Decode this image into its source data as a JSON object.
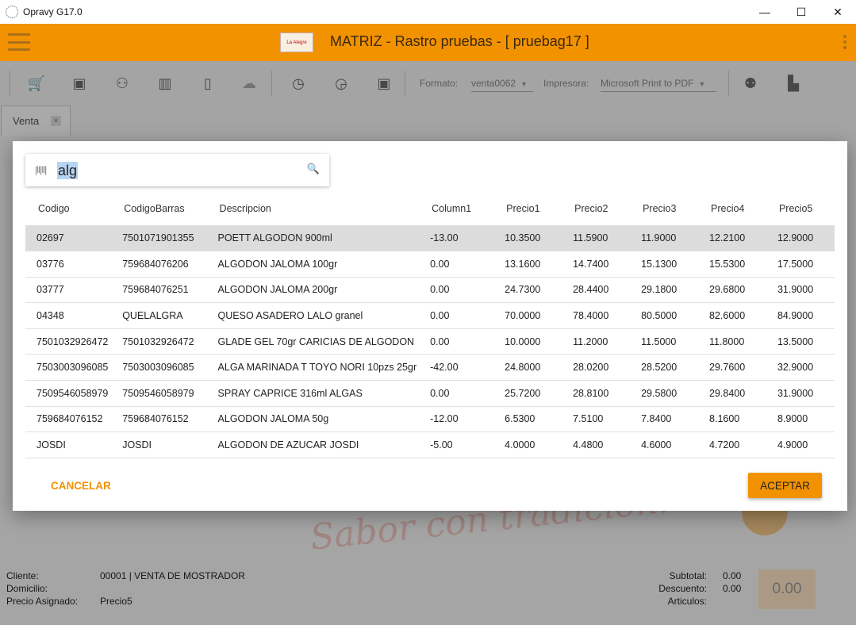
{
  "window": {
    "title": "Opravy G17.0",
    "minimize": "—",
    "maximize": "☐",
    "close": "✕"
  },
  "appbar": {
    "title": "MATRIZ - Rastro pruebas - [ pruebag17 ]",
    "logo_text": "La Alegre"
  },
  "toolbar": {
    "formato_label": "Formato:",
    "formato_value": "venta0062",
    "impresora_label": "Impresora:",
    "impresora_value": "Microsoft Print to PDF"
  },
  "tab": {
    "label": "Venta",
    "close": "✕"
  },
  "watermark": "Sabor con tradición!!",
  "footer": {
    "cliente_label": "Cliente:",
    "cliente_value": "00001 | VENTA DE MOSTRADOR",
    "domicilio_label": "Domicilio:",
    "domicilio_value": "",
    "precio_label": "Precio Asignado:",
    "precio_value": "Precio5",
    "subtotal_label": "Subtotal:",
    "subtotal_value": "0.00",
    "descuento_label": "Descuento:",
    "descuento_value": "0.00",
    "articulos_label": "Articulos:",
    "articulos_value": "",
    "total": "0.00"
  },
  "dialog": {
    "search_value": "alg",
    "columns": [
      "Codigo",
      "CodigoBarras",
      "Descripcion",
      "Column1",
      "Precio1",
      "Precio2",
      "Precio3",
      "Precio4",
      "Precio5"
    ],
    "rows": [
      [
        "02697",
        "7501071901355",
        "POETT ALGODON 900ml",
        "-13.00",
        "10.3500",
        "11.5900",
        "11.9000",
        "12.2100",
        "12.9000"
      ],
      [
        "03776",
        "759684076206",
        "ALGODON JALOMA 100gr",
        "0.00",
        "13.1600",
        "14.7400",
        "15.1300",
        "15.5300",
        "17.5000"
      ],
      [
        "03777",
        "759684076251",
        "ALGODON JALOMA 200gr",
        "0.00",
        "24.7300",
        "28.4400",
        "29.1800",
        "29.6800",
        "31.9000"
      ],
      [
        "04348",
        "QUELALGRA",
        "QUESO ASADERO LALO granel",
        "0.00",
        "70.0000",
        "78.4000",
        "80.5000",
        "82.6000",
        "84.9000"
      ],
      [
        "7501032926472",
        "7501032926472",
        "GLADE GEL 70gr CARICIAS DE ALGODON",
        "0.00",
        "10.0000",
        "11.2000",
        "11.5000",
        "11.8000",
        "13.5000"
      ],
      [
        "7503003096085",
        "7503003096085",
        "ALGA MARINADA T TOYO NORI 10pzs 25gr",
        "-42.00",
        "24.8000",
        "28.0200",
        "28.5200",
        "29.7600",
        "32.9000"
      ],
      [
        "7509546058979",
        "7509546058979",
        "SPRAY CAPRICE 316ml ALGAS",
        "0.00",
        "25.7200",
        "28.8100",
        "29.5800",
        "29.8400",
        "31.9000"
      ],
      [
        "759684076152",
        "759684076152",
        "ALGODON JALOMA 50g",
        "-12.00",
        "6.5300",
        "7.5100",
        "7.8400",
        "8.1600",
        "8.9000"
      ],
      [
        "JOSDI",
        "JOSDI",
        "ALGODON DE AZUCAR JOSDI",
        "-5.00",
        "4.0000",
        "4.4800",
        "4.6000",
        "4.7200",
        "4.9000"
      ]
    ],
    "selected_row": 0,
    "cancel_label": "CANCELAR",
    "accept_label": "ACEPTAR"
  },
  "icons": [
    "cart-icon",
    "cash-icon",
    "people-icon",
    "barcode-icon",
    "tablet-icon",
    "cloud-sync-icon",
    "clock-icon",
    "clock-check-icon",
    "money-icon",
    "add-person-icon",
    "cashier-icon",
    "search-icon"
  ],
  "colors": {
    "accent": "#f29200",
    "selected_row": "#dcdcdc",
    "selection": "#b6d4f2"
  }
}
